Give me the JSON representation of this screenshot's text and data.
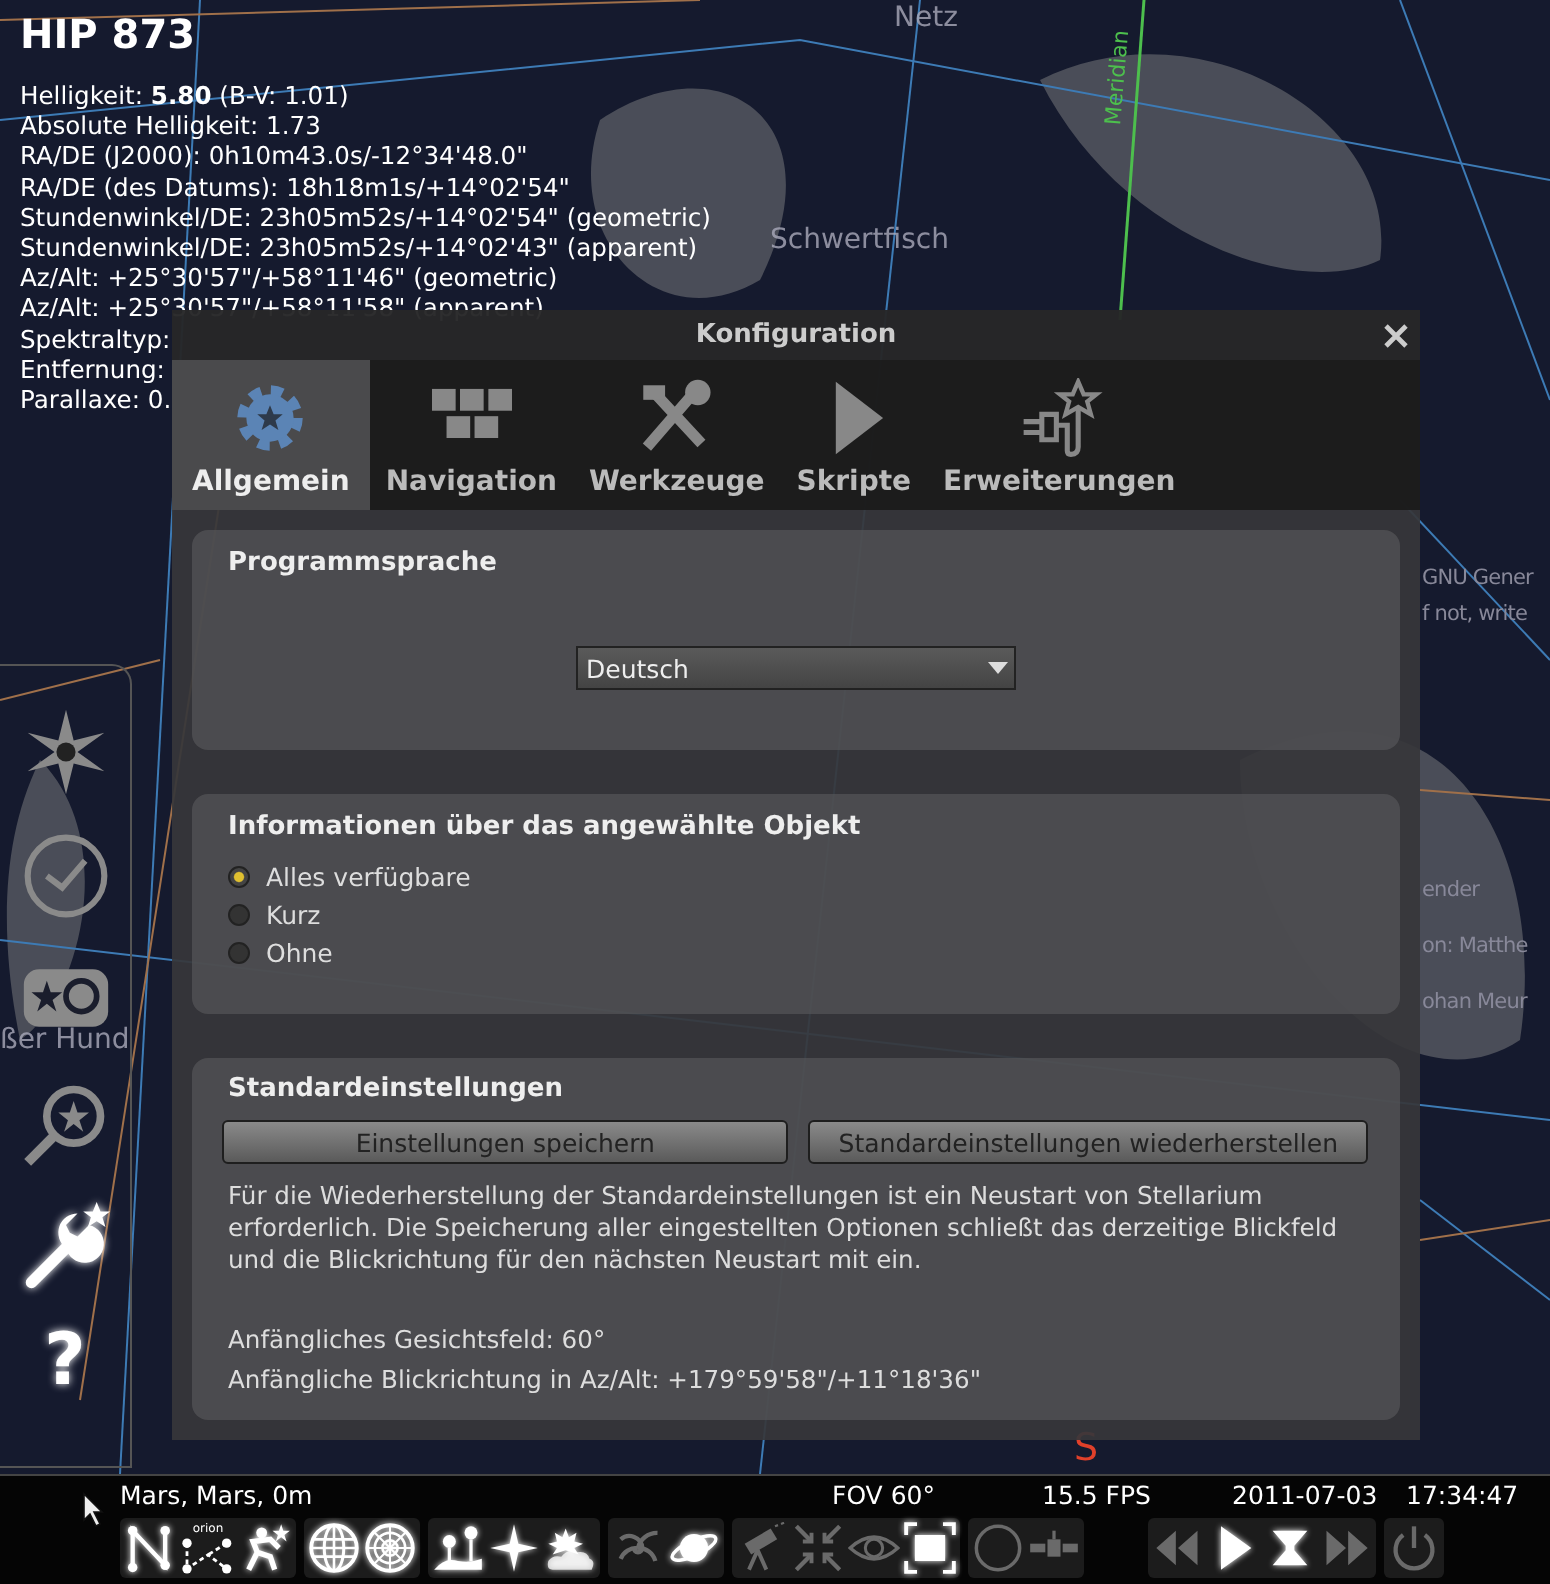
{
  "sky_labels": [
    {
      "kind": "constellation",
      "text": "Netz"
    },
    {
      "kind": "meridian",
      "text": "Meridian"
    },
    {
      "kind": "constellation",
      "text": "Schwertfisch"
    },
    {
      "kind": "constellation",
      "text": "ßer Hund"
    },
    {
      "kind": "cardinal",
      "text": "S"
    }
  ],
  "background_fragments": [
    "GNU Gener",
    "f not, write",
    "ender",
    "on: Matthe",
    "ohan Meur"
  ],
  "object_info": {
    "title": "HIP 873",
    "lines": [
      "Helligkeit: **5.80** (B-V: 1.01)",
      "Absolute Helligkeit: 1.73",
      "RA/DE (J2000): 0h10m43.0s/-12°34'48.0\"",
      "RA/DE (des Datums): 18h18m1s/+14°02'54\"",
      "Stundenwinkel/DE: 23h05m52s/+14°02'54\" (geometric)",
      "Stundenwinkel/DE: 23h05m52s/+14°02'43\" (apparent)",
      "Az/Alt: +25°30'57\"/+58°11'46\" (geometric)",
      "Az/Alt: +25°30'57\"/+58°11'58\" (apparent)",
      "Spektraltyp:",
      "Entfernung:",
      "Parallaxe: 0."
    ]
  },
  "side_toolbar": [
    {
      "kind": "location",
      "on": false
    },
    {
      "kind": "time",
      "on": false
    },
    {
      "kind": "sky",
      "on": false
    },
    {
      "kind": "search",
      "on": false
    },
    {
      "kind": "settings",
      "on": true
    },
    {
      "kind": "help",
      "label": "?",
      "on": true
    }
  ],
  "dialog": {
    "title": "Konfiguration",
    "tabs": [
      {
        "kind": "gear",
        "label": "Allgemein",
        "selected": true
      },
      {
        "kind": "keypad",
        "label": "Navigation",
        "selected": false
      },
      {
        "kind": "tools",
        "label": "Werkzeuge",
        "selected": false
      },
      {
        "kind": "play",
        "label": "Skripte",
        "selected": false
      },
      {
        "kind": "plugin",
        "label": "Erweiterungen",
        "selected": false
      }
    ],
    "language": {
      "heading": "Programmsprache",
      "value": "Deutsch"
    },
    "info": {
      "heading": "Informationen über das angewählte Objekt",
      "options": [
        {
          "label": "Alles verfügbare",
          "selected": true
        },
        {
          "label": "Kurz",
          "selected": false
        },
        {
          "label": "Ohne",
          "selected": false
        }
      ]
    },
    "defaults": {
      "heading": "Standardeinstellungen",
      "buttons": [
        "Einstellungen speichern",
        "Standardeinstellungen wiederherstellen"
      ],
      "note": "Für die Wiederherstellung der Standardeinstellungen ist ein Neustart von Stellarium erforderlich. Die Speicherung aller eingestellten Optionen schließt das derzeitige Blickfeld und die Blickrichtung für den nächsten Neustart mit ein.",
      "fov": "Anfängliches Gesichtsfeld: 60°",
      "direction": "Anfängliche Blickrichtung in Az/Alt: +179°59'58\"/+11°18'36\""
    }
  },
  "status": {
    "location": "Mars, Mars, 0m",
    "fov": "FOV 60°",
    "fps": "15.5 FPS",
    "date": "2011-07-03",
    "time": "17:34:47"
  },
  "bottom_toolbar": [
    [
      {
        "kind": "constellation-lines",
        "on": true
      },
      {
        "kind": "constellation-names",
        "label": "orion",
        "on": true
      },
      {
        "kind": "constellation-art",
        "on": true
      }
    ],
    [
      {
        "kind": "equatorial-grid",
        "on": true
      },
      {
        "kind": "azimuthal-grid",
        "on": true
      }
    ],
    [
      {
        "kind": "ground",
        "on": true
      },
      {
        "kind": "cardinal-points",
        "on": true
      },
      {
        "kind": "atmosphere",
        "on": true
      }
    ],
    [
      {
        "kind": "nebulae",
        "on": false
      },
      {
        "kind": "planets",
        "on": true
      }
    ],
    [
      {
        "kind": "telescope",
        "on": false
      },
      {
        "kind": "center",
        "on": false
      },
      {
        "kind": "night-mode",
        "on": false
      },
      {
        "kind": "fullscreen",
        "on": true
      }
    ],
    [
      {
        "kind": "circle",
        "on": false
      },
      {
        "kind": "satellite",
        "on": false
      }
    ],
    [
      {
        "kind": "rewind",
        "on": false
      },
      {
        "kind": "play",
        "on": true
      },
      {
        "kind": "now",
        "on": true
      },
      {
        "kind": "forward",
        "on": false
      }
    ],
    [
      {
        "kind": "quit",
        "on": false
      }
    ]
  ]
}
